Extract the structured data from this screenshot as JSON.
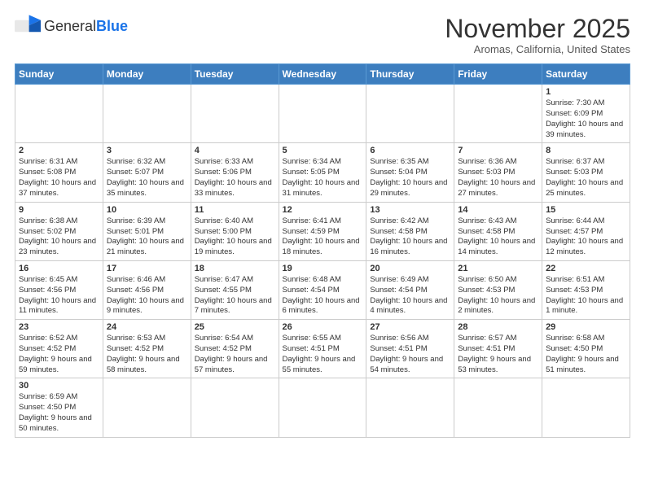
{
  "header": {
    "logo_text_general": "General",
    "logo_text_blue": "Blue",
    "title": "November 2025",
    "subtitle": "Aromas, California, United States"
  },
  "days_of_week": [
    "Sunday",
    "Monday",
    "Tuesday",
    "Wednesday",
    "Thursday",
    "Friday",
    "Saturday"
  ],
  "weeks": [
    [
      {
        "day": "",
        "info": ""
      },
      {
        "day": "",
        "info": ""
      },
      {
        "day": "",
        "info": ""
      },
      {
        "day": "",
        "info": ""
      },
      {
        "day": "",
        "info": ""
      },
      {
        "day": "",
        "info": ""
      },
      {
        "day": "1",
        "info": "Sunrise: 7:30 AM\nSunset: 6:09 PM\nDaylight: 10 hours and 39 minutes."
      }
    ],
    [
      {
        "day": "2",
        "info": "Sunrise: 6:31 AM\nSunset: 5:08 PM\nDaylight: 10 hours and 37 minutes."
      },
      {
        "day": "3",
        "info": "Sunrise: 6:32 AM\nSunset: 5:07 PM\nDaylight: 10 hours and 35 minutes."
      },
      {
        "day": "4",
        "info": "Sunrise: 6:33 AM\nSunset: 5:06 PM\nDaylight: 10 hours and 33 minutes."
      },
      {
        "day": "5",
        "info": "Sunrise: 6:34 AM\nSunset: 5:05 PM\nDaylight: 10 hours and 31 minutes."
      },
      {
        "day": "6",
        "info": "Sunrise: 6:35 AM\nSunset: 5:04 PM\nDaylight: 10 hours and 29 minutes."
      },
      {
        "day": "7",
        "info": "Sunrise: 6:36 AM\nSunset: 5:03 PM\nDaylight: 10 hours and 27 minutes."
      },
      {
        "day": "8",
        "info": "Sunrise: 6:37 AM\nSunset: 5:03 PM\nDaylight: 10 hours and 25 minutes."
      }
    ],
    [
      {
        "day": "9",
        "info": "Sunrise: 6:38 AM\nSunset: 5:02 PM\nDaylight: 10 hours and 23 minutes."
      },
      {
        "day": "10",
        "info": "Sunrise: 6:39 AM\nSunset: 5:01 PM\nDaylight: 10 hours and 21 minutes."
      },
      {
        "day": "11",
        "info": "Sunrise: 6:40 AM\nSunset: 5:00 PM\nDaylight: 10 hours and 19 minutes."
      },
      {
        "day": "12",
        "info": "Sunrise: 6:41 AM\nSunset: 4:59 PM\nDaylight: 10 hours and 18 minutes."
      },
      {
        "day": "13",
        "info": "Sunrise: 6:42 AM\nSunset: 4:58 PM\nDaylight: 10 hours and 16 minutes."
      },
      {
        "day": "14",
        "info": "Sunrise: 6:43 AM\nSunset: 4:58 PM\nDaylight: 10 hours and 14 minutes."
      },
      {
        "day": "15",
        "info": "Sunrise: 6:44 AM\nSunset: 4:57 PM\nDaylight: 10 hours and 12 minutes."
      }
    ],
    [
      {
        "day": "16",
        "info": "Sunrise: 6:45 AM\nSunset: 4:56 PM\nDaylight: 10 hours and 11 minutes."
      },
      {
        "day": "17",
        "info": "Sunrise: 6:46 AM\nSunset: 4:56 PM\nDaylight: 10 hours and 9 minutes."
      },
      {
        "day": "18",
        "info": "Sunrise: 6:47 AM\nSunset: 4:55 PM\nDaylight: 10 hours and 7 minutes."
      },
      {
        "day": "19",
        "info": "Sunrise: 6:48 AM\nSunset: 4:54 PM\nDaylight: 10 hours and 6 minutes."
      },
      {
        "day": "20",
        "info": "Sunrise: 6:49 AM\nSunset: 4:54 PM\nDaylight: 10 hours and 4 minutes."
      },
      {
        "day": "21",
        "info": "Sunrise: 6:50 AM\nSunset: 4:53 PM\nDaylight: 10 hours and 2 minutes."
      },
      {
        "day": "22",
        "info": "Sunrise: 6:51 AM\nSunset: 4:53 PM\nDaylight: 10 hours and 1 minute."
      }
    ],
    [
      {
        "day": "23",
        "info": "Sunrise: 6:52 AM\nSunset: 4:52 PM\nDaylight: 9 hours and 59 minutes."
      },
      {
        "day": "24",
        "info": "Sunrise: 6:53 AM\nSunset: 4:52 PM\nDaylight: 9 hours and 58 minutes."
      },
      {
        "day": "25",
        "info": "Sunrise: 6:54 AM\nSunset: 4:52 PM\nDaylight: 9 hours and 57 minutes."
      },
      {
        "day": "26",
        "info": "Sunrise: 6:55 AM\nSunset: 4:51 PM\nDaylight: 9 hours and 55 minutes."
      },
      {
        "day": "27",
        "info": "Sunrise: 6:56 AM\nSunset: 4:51 PM\nDaylight: 9 hours and 54 minutes."
      },
      {
        "day": "28",
        "info": "Sunrise: 6:57 AM\nSunset: 4:51 PM\nDaylight: 9 hours and 53 minutes."
      },
      {
        "day": "29",
        "info": "Sunrise: 6:58 AM\nSunset: 4:50 PM\nDaylight: 9 hours and 51 minutes."
      }
    ],
    [
      {
        "day": "30",
        "info": "Sunrise: 6:59 AM\nSunset: 4:50 PM\nDaylight: 9 hours and 50 minutes."
      },
      {
        "day": "",
        "info": ""
      },
      {
        "day": "",
        "info": ""
      },
      {
        "day": "",
        "info": ""
      },
      {
        "day": "",
        "info": ""
      },
      {
        "day": "",
        "info": ""
      },
      {
        "day": "",
        "info": ""
      }
    ]
  ],
  "colors": {
    "header_bg": "#3d7ebf",
    "border": "#cccccc"
  }
}
